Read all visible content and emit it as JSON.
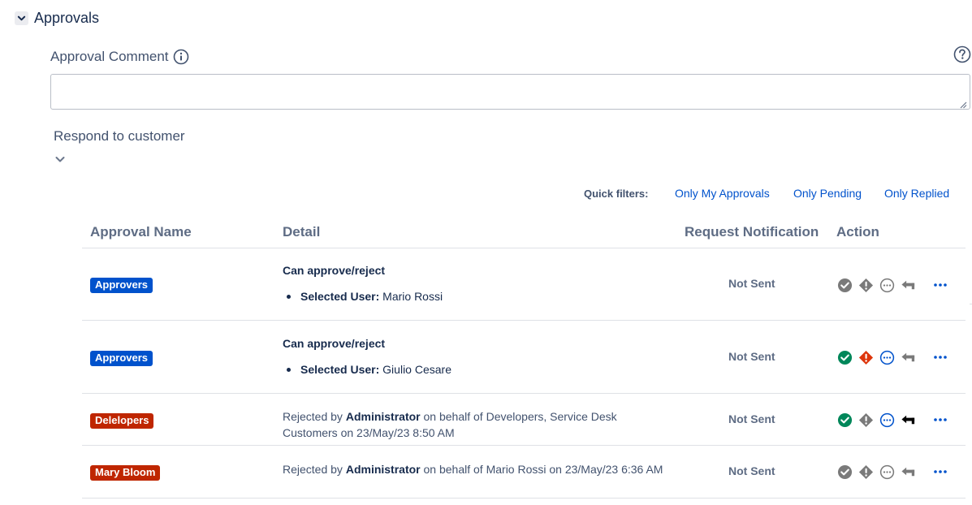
{
  "section": {
    "title": "Approvals"
  },
  "comment": {
    "label": "Approval Comment",
    "value": "",
    "placeholder": ""
  },
  "respond": {
    "label": "Respond to customer"
  },
  "quick_filters": {
    "label": "Quick filters:",
    "items": [
      "Only My Approvals",
      "Only Pending",
      "Only Replied"
    ]
  },
  "table": {
    "headers": [
      "Approval Name",
      "Detail",
      "Request Notification",
      "Action"
    ],
    "rows": [
      {
        "name": "Approvers",
        "badge_color": "#0052cc",
        "detail_title": "Can approve/reject",
        "selected_label": "Selected User:",
        "selected_value": "Mario Rossi",
        "notification": "Not Sent",
        "action_state": "disabled"
      },
      {
        "name": "Approvers",
        "badge_color": "#0052cc",
        "detail_title": "Can approve/reject",
        "selected_label": "Selected User:",
        "selected_value": "Giulio Cesare",
        "notification": "Not Sent",
        "action_state": "enabled"
      },
      {
        "name": "Delelopers",
        "badge_color": "#bf2600",
        "detail_prefix": "Rejected by",
        "detail_actor": "Administrator",
        "detail_suffix": "on behalf of Developers, Service Desk Customers on 23/May/23 8:50 AM",
        "notification": "Not Sent",
        "action_state": "partial"
      },
      {
        "name": "Mary Bloom",
        "badge_color": "#bf2600",
        "detail_prefix": "Rejected by",
        "detail_actor": "Administrator",
        "detail_suffix": "on behalf of Mario Rossi on 23/May/23 6:36 AM",
        "notification": "Not Sent",
        "action_state": "disabled"
      }
    ]
  },
  "icons": {
    "section_toggle": "chevron-down-icon",
    "info": "info-icon",
    "help": "help-icon",
    "approve": "check-circle-icon",
    "reject": "reject-diamond-icon",
    "more_info": "ellipsis-circle-icon",
    "reply": "reply-arrow-icon",
    "more": "more-horizontal-icon"
  },
  "colors": {
    "approve_active": "#00875a",
    "reject_active": "#de350b",
    "info_active": "#0052cc",
    "disabled": "#7a7a7a",
    "link": "#0052cc"
  }
}
